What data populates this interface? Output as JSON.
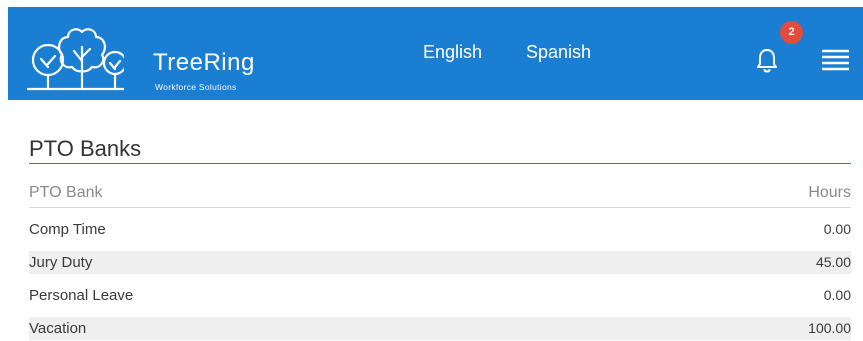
{
  "header": {
    "brand_name": "TreeRing",
    "brand_tagline": "Workforce Solutions",
    "lang_english": "English",
    "lang_spanish": "Spanish",
    "notification_count": "2",
    "colors": {
      "header_bg": "#1a7fd3",
      "badge_bg": "#e64a3c"
    }
  },
  "section": {
    "title": "PTO Banks"
  },
  "table": {
    "columns": [
      "PTO Bank",
      "Hours"
    ],
    "rows": [
      {
        "name": "Comp Time",
        "hours": "0.00"
      },
      {
        "name": "Jury Duty",
        "hours": "45.00"
      },
      {
        "name": "Personal Leave",
        "hours": "0.00"
      },
      {
        "name": "Vacation",
        "hours": "100.00"
      }
    ]
  },
  "icons": {
    "logo": "tree-logo-icon",
    "bell": "bell-icon",
    "menu": "hamburger-menu-icon"
  }
}
